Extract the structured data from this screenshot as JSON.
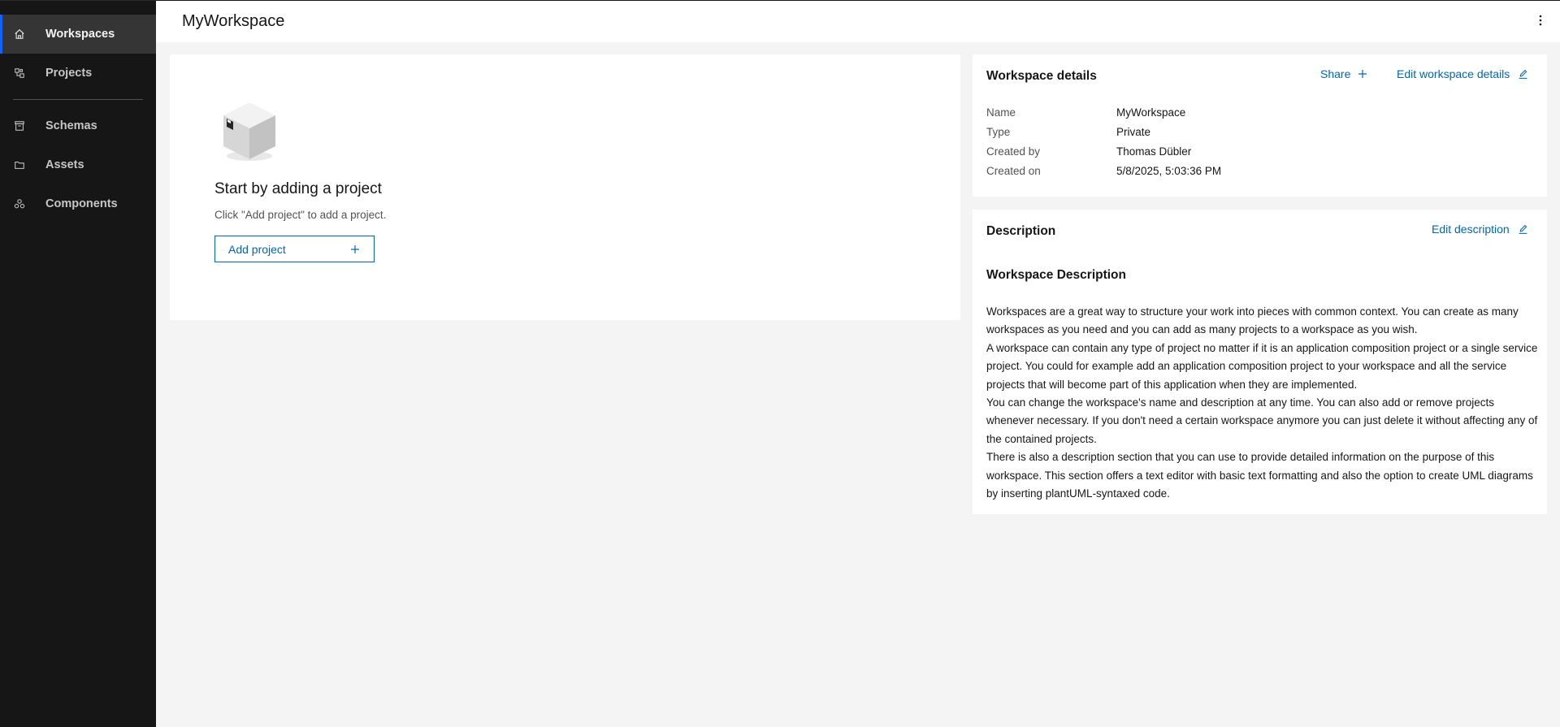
{
  "sidebar": {
    "items": [
      {
        "label": "Workspaces",
        "icon": "home-icon",
        "active": true
      },
      {
        "label": "Projects",
        "icon": "projects-icon"
      },
      {
        "label": "Schemas",
        "icon": "schemas-icon"
      },
      {
        "label": "Assets",
        "icon": "folder-icon"
      },
      {
        "label": "Components",
        "icon": "components-icon"
      }
    ]
  },
  "header": {
    "title": "MyWorkspace",
    "overflow_icon": "overflow-menu-vertical-icon"
  },
  "empty_state": {
    "title": "Start by adding a project",
    "subtitle": "Click \"Add project\" to add a project.",
    "add_button": "Add project",
    "add_icon": "plus-icon"
  },
  "details": {
    "title": "Workspace details",
    "share_label": "Share",
    "edit_label": "Edit workspace details",
    "fields": [
      {
        "label": "Name",
        "value": "MyWorkspace"
      },
      {
        "label": "Type",
        "value": "Private"
      },
      {
        "label": "Created by",
        "value": "Thomas Dübler"
      },
      {
        "label": "Created on",
        "value": "5/8/2025, 5:03:36 PM"
      }
    ]
  },
  "description": {
    "title": "Description",
    "edit_label": "Edit description",
    "heading": "Workspace Description",
    "paragraphs": [
      "Workspaces are a great way to structure your work into pieces with common context. You can create as many workspaces as you need and you can add as many projects to a workspace as you wish.",
      "A workspace can contain any type of project no matter if it is an application composition project or a single service project. You could for example add an application composition project to your workspace and all the service projects that will become part of this application when they are implemented.",
      "You can change the workspace's name and description at any time. You can also add or remove projects whenever necessary. If you don't need a certain workspace anymore you can just delete it without affecting any of the contained projects.",
      "There is also a description section that you can use to provide detailed information on the purpose of this workspace. This section offers a text editor with basic text formatting and also the option to create UML diagrams by inserting plantUML-syntaxed code."
    ]
  },
  "colors": {
    "sidebar_bg": "#161616",
    "active_indicator": "#0f62fe",
    "link": "#0066b3",
    "page_bg": "#f4f4f4"
  }
}
